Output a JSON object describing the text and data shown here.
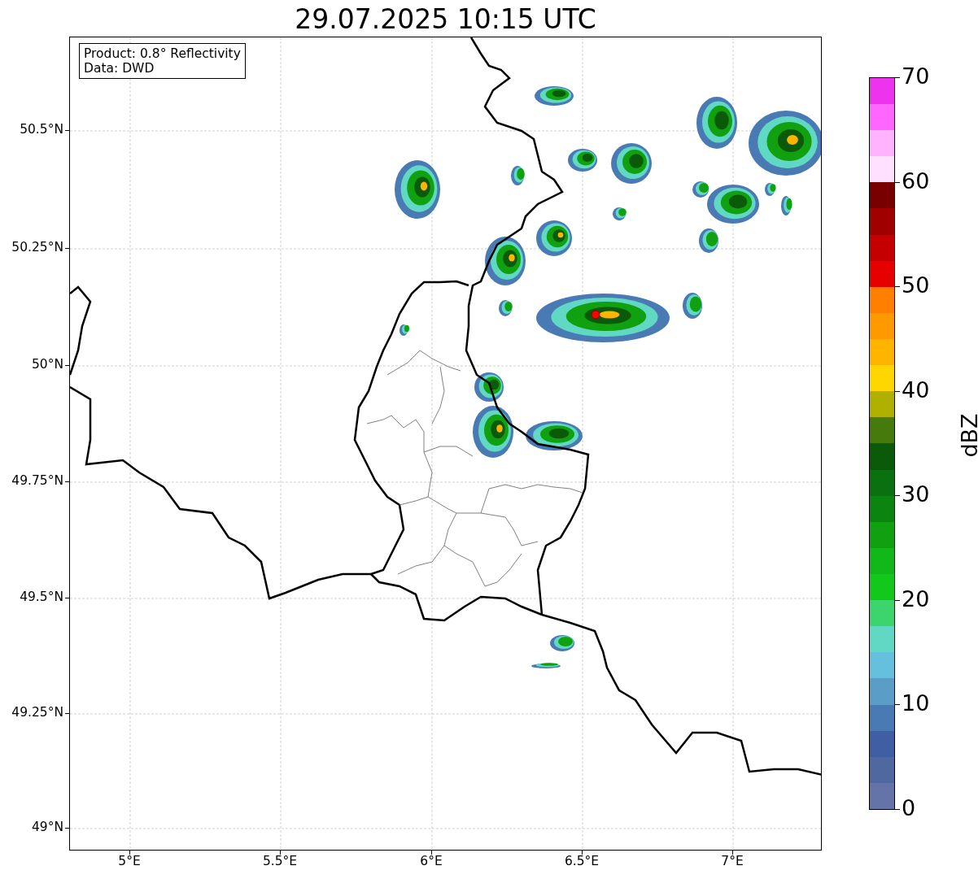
{
  "title": "29.07.2025 10:15 UTC",
  "info_box": {
    "lines": [
      "Product: 0.8° Reflectivity",
      "Data: DWD"
    ]
  },
  "map": {
    "yticks": [
      "50.5°N",
      "50.25°N",
      "50°N",
      "49.75°N",
      "49.5°N",
      "49.25°N",
      "49°N"
    ],
    "xticks": [
      "5°E",
      "5.5°E",
      "6°E",
      "6.5°E",
      "7°E"
    ]
  },
  "colorbar": {
    "label": "dBZ",
    "ticks": [
      "70",
      "60",
      "50",
      "40",
      "30",
      "20",
      "10",
      "0"
    ],
    "segments": [
      {
        "color": "#6474a8"
      },
      {
        "color": "#5068a0"
      },
      {
        "color": "#405ea4"
      },
      {
        "color": "#4a7ab4"
      },
      {
        "color": "#5a9ec8"
      },
      {
        "color": "#64c0dc"
      },
      {
        "color": "#60d8c4"
      },
      {
        "color": "#3cd46c"
      },
      {
        "color": "#12c81a"
      },
      {
        "color": "#12b81a"
      },
      {
        "color": "#10a010"
      },
      {
        "color": "#0c8510"
      },
      {
        "color": "#0a7010"
      },
      {
        "color": "#0a5a0a"
      },
      {
        "color": "#467a0c"
      },
      {
        "color": "#b0b000"
      },
      {
        "color": "#ffd700"
      },
      {
        "color": "#ffb400"
      },
      {
        "color": "#ff9900"
      },
      {
        "color": "#ff7f00"
      },
      {
        "color": "#e60000"
      },
      {
        "color": "#c40000"
      },
      {
        "color": "#a00000"
      },
      {
        "color": "#780000"
      },
      {
        "color": "#ffe0ff"
      },
      {
        "color": "#ffb3ff"
      },
      {
        "color": "#ff66ff"
      },
      {
        "color": "#ee33ee"
      }
    ]
  }
}
